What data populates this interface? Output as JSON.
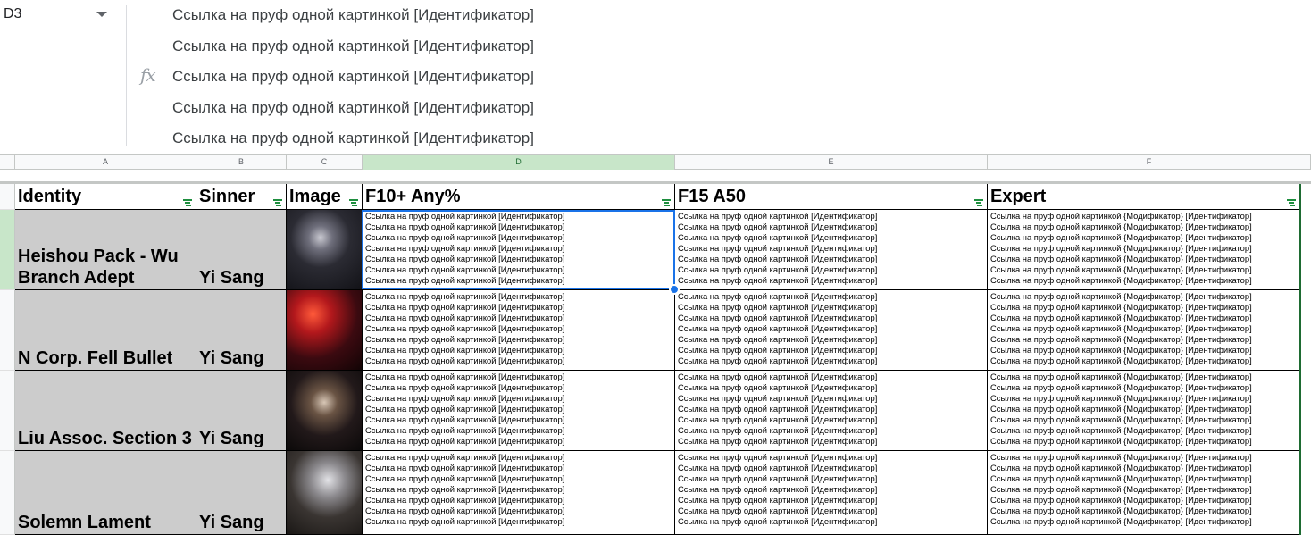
{
  "formula_bar": {
    "name_box": "D3",
    "formula_lines": [
      "Ссылка на пруф одной картинкой [Идентификатор]",
      "Ссылка на пруф одной картинкой [Идентификатор]",
      "Ссылка на пруф одной картинкой [Идентификатор]",
      "Ссылка на пруф одной картинкой [Идентификатор]",
      "Ссылка на пруф одной картинкой [Идентификатор]"
    ],
    "fx_icon": "fx-icon"
  },
  "column_letters": [
    "A",
    "B",
    "C",
    "D",
    "E",
    "F"
  ],
  "active_column": "D",
  "headers": {
    "identity": "Identity",
    "sinner": "Sinner",
    "image": "Image",
    "f10": "F10+ Any%",
    "f15": "F15 A50",
    "expert": "Expert"
  },
  "proof_texts": {
    "standard": "Ссылка на пруф одной картинкой [Идентификатор]",
    "expert": "Ссылка на пруф одной картинкой {Модификатор} [Идентификатор]"
  },
  "rows": [
    {
      "identity": "Heishou Pack - Wu Branch Adept",
      "sinner": "Yi Sang",
      "image": "character-portrait-dark-armored",
      "f10": [
        "Ссылка на пруф одной картинкой [Идентификатор]",
        "Ссылка на пруф одной картинкой [Идентификатор]",
        "Ссылка на пруф одной картинкой [Идентификатор]",
        "Ссылка на пруф одной картинкой [Идентификатор]",
        "Ссылка на пруф одной картинкой [Идентификатор]",
        "Ссылка на пруф одной картинкой [Идентификатор]",
        "Ссылка на пруф одной картинкой [Идентификатор]"
      ],
      "f15": [
        "Ссылка на пруф одной картинкой [Идентификатор]",
        "Ссылка на пруф одной картинкой [Идентификатор]",
        "Ссылка на пруф одной картинкой [Идентификатор]",
        "Ссылка на пруф одной картинкой [Идентификатор]",
        "Ссылка на пруф одной картинкой [Идентификатор]",
        "Ссылка на пруф одной картинкой [Идентификатор]",
        "Ссылка на пруф одной картинкой [Идентификатор]"
      ],
      "expert": [
        "Ссылка на пруф одной картинкой {Модификатор} [Идентификатор]",
        "Ссылка на пруф одной картинкой {Модификатор} [Идентификатор]",
        "Ссылка на пруф одной картинкой {Модификатор} [Идентификатор]",
        "Ссылка на пруф одной картинкой {Модификатор} [Идентификатор]",
        "Ссылка на пруф одной картинкой {Модификатор} [Идентификатор]",
        "Ссылка на пруф одной картинкой {Модификатор} [Идентификатор]",
        "Ссылка на пруф одной картинкой {Модификатор} [Идентификатор]"
      ]
    },
    {
      "identity": "N Corp. Fell Bullet",
      "sinner": "Yi Sang",
      "image": "character-portrait-red-hair-gunner",
      "f10": [
        "Ссылка на пруф одной картинкой [Идентификатор]",
        "Ссылка на пруф одной картинкой [Идентификатор]",
        "Ссылка на пруф одной картинкой [Идентификатор]",
        "Ссылка на пруф одной картинкой [Идентификатор]",
        "Ссылка на пруф одной картинкой [Идентификатор]",
        "Ссылка на пруф одной картинкой [Идентификатор]",
        "Ссылка на пруф одной картинкой [Идентификатор]"
      ],
      "f15": [
        "Ссылка на пруф одной картинкой [Идентификатор]",
        "Ссылка на пруф одной картинкой [Идентификатор]",
        "Ссылка на пруф одной картинкой [Идентификатор]",
        "Ссылка на пруф одной картинкой [Идентификатор]",
        "Ссылка на пруф одной картинкой [Идентификатор]",
        "Ссылка на пруф одной картинкой [Идентификатор]",
        "Ссылка на пруф одной картинкой [Идентификатор]"
      ],
      "expert": [
        "Ссылка на пруф одной картинкой {Модификатор} [Идентификатор]",
        "Ссылка на пруф одной картинкой {Модификатор} [Идентификатор]",
        "Ссылка на пруф одной картинкой {Модификатор} [Идентификатор]",
        "Ссылка на пруф одной картинкой {Модификатор} [Идентификатор]",
        "Ссылка на пруф одной картинкой {Модификатор} [Идентификатор]",
        "Ссылка на пруф одной картинкой {Модификатор} [Идентификатор]",
        "Ссылка на пруф одной картинкой {Модификатор} [Идентификатор]"
      ]
    },
    {
      "identity": "Liu Assoc. Section 3",
      "sinner": "Yi Sang",
      "image": "character-portrait-dark-coat",
      "f10": [
        "Ссылка на пруф одной картинкой [Идентификатор]",
        "Ссылка на пруф одной картинкой [Идентификатор]",
        "Ссылка на пруф одной картинкой [Идентификатор]",
        "Ссылка на пруф одной картинкой [Идентификатор]",
        "Ссылка на пруф одной картинкой [Идентификатор]",
        "Ссылка на пруф одной картинкой [Идентификатор]",
        "Ссылка на пруф одной картинкой [Идентификатор]"
      ],
      "f15": [
        "Ссылка на пруф одной картинкой [Идентификатор]",
        "Ссылка на пруф одной картинкой [Идентификатор]",
        "Ссылка на пруф одной картинкой [Идентификатор]",
        "Ссылка на пруф одной картинкой [Идентификатор]",
        "Ссылка на пруф одной картинкой [Идентификатор]",
        "Ссылка на пруф одной картинкой [Идентификатор]",
        "Ссылка на пруф одной картинкой [Идентификатор]"
      ],
      "expert": [
        "Ссылка на пруф одной картинкой {Модификатор} [Идентификатор]",
        "Ссылка на пруф одной картинкой {Модификатор} [Идентификатор]",
        "Ссылка на пруф одной картинкой {Модификатор} [Идентификатор]",
        "Ссылка на пруф одной картинкой {Модификатор} [Идентификатор]",
        "Ссылка на пруф одной картинкой {Модификатор} [Идентификатор]",
        "Ссылка на пруф одной картинкой {Модификатор} [Идентификатор]",
        "Ссылка на пруф одной картинкой {Модификатор} [Идентификатор]"
      ]
    },
    {
      "identity": "Solemn Lament",
      "sinner": "Yi Sang",
      "image": "character-portrait-grey-suit",
      "f10": [
        "Ссылка на пруф одной картинкой [Идентификатор]",
        "Ссылка на пруф одной картинкой [Идентификатор]",
        "Ссылка на пруф одной картинкой [Идентификатор]",
        "Ссылка на пруф одной картинкой [Идентификатор]",
        "Ссылка на пруф одной картинкой [Идентификатор]",
        "Ссылка на пруф одной картинкой [Идентификатор]",
        "Ссылка на пруф одной картинкой [Идентификатор]"
      ],
      "f15": [
        "Ссылка на пруф одной картинкой [Идентификатор]",
        "Ссылка на пруф одной картинкой [Идентификатор]",
        "Ссылка на пруф одной картинкой [Идентификатор]",
        "Ссылка на пруф одной картинкой [Идентификатор]",
        "Ссылка на пруф одной картинкой [Идентификатор]",
        "Ссылка на пруф одной картинкой [Идентификатор]",
        "Ссылка на пруф одной картинкой [Идентификатор]"
      ],
      "expert": [
        "Ссылка на пруф одной картинкой {Модификатор} [Идентификатор]",
        "Ссылка на пруф одной картинкой {Модификатор} [Идентификатор]",
        "Ссылка на пруф одной картинкой {Модификатор} [Идентификатор]",
        "Ссылка на пруф одной картинкой {Модификатор} [Идентификатор]",
        "Ссылка на пруф одной картинкой {Модификатор} [Идентификатор]",
        "Ссылка на пруф одной картинкой {Модификатор} [Идентификатор]",
        "Ссылка на пруф одной картинкой {Модификатор} [Идентификатор]"
      ]
    }
  ],
  "colors": {
    "selection": "#1a73e8",
    "active_header": "#c8e6c9",
    "identity_bg": "#cccccc",
    "filter_icon": "#1e8e3e"
  }
}
